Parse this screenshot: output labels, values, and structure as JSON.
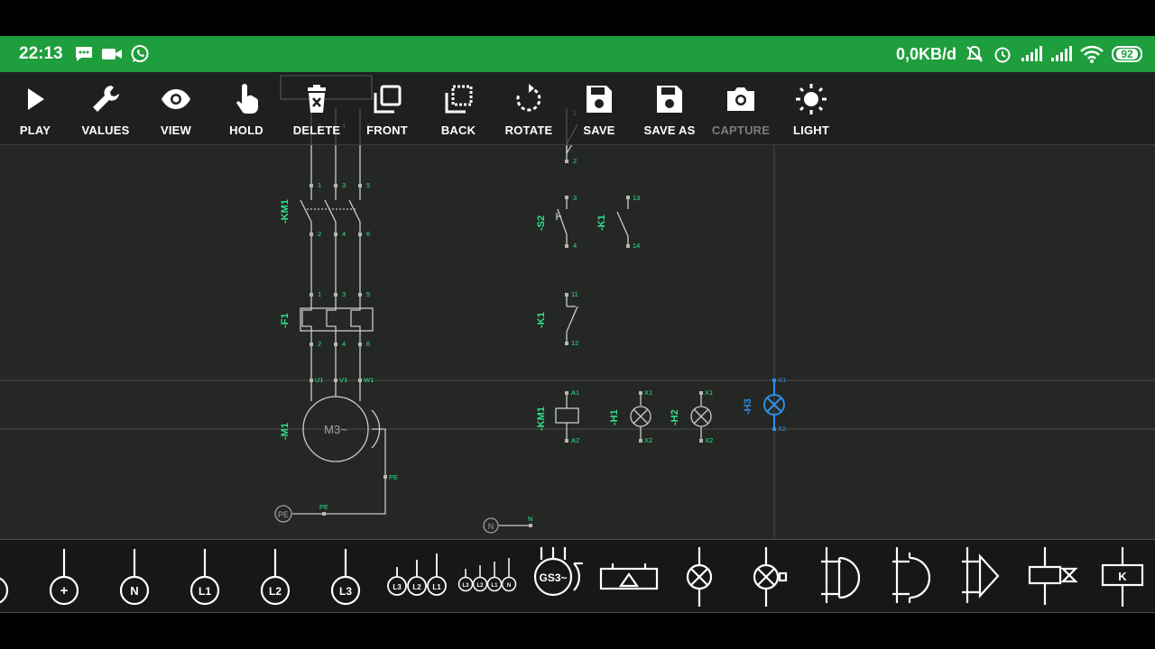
{
  "status": {
    "time": "22:13",
    "net_speed": "0,0KB/d",
    "battery": "92",
    "icons": [
      "chat-icon",
      "video-icon",
      "whatsapp-icon",
      "mute-icon",
      "alarm-icon",
      "signal-icon",
      "signal-icon",
      "wifi-icon"
    ]
  },
  "toolbar": [
    {
      "label": "PLAY",
      "icon": "play-icon"
    },
    {
      "label": "VALUES",
      "icon": "wrench-icon"
    },
    {
      "label": "VIEW",
      "icon": "eye-icon"
    },
    {
      "label": "HOLD",
      "icon": "hand-icon"
    },
    {
      "label": "DELETE",
      "icon": "trash-icon"
    },
    {
      "label": "FRONT",
      "icon": "bring-front-icon"
    },
    {
      "label": "BACK",
      "icon": "send-back-icon"
    },
    {
      "label": "ROTATE",
      "icon": "rotate-icon"
    },
    {
      "label": "SAVE",
      "icon": "save-icon"
    },
    {
      "label": "SAVE AS",
      "icon": "save-as-icon"
    },
    {
      "label": "CAPTURE",
      "icon": "camera-icon",
      "disabled": true
    },
    {
      "label": "LIGHT",
      "icon": "sun-icon"
    }
  ],
  "colors": {
    "accent": "#1e9e3c",
    "label": "#2ee28a",
    "selected": "#2d8fe6",
    "wire": "#c9cbc9"
  },
  "schematic": {
    "devices": {
      "km1_main": "-KM1",
      "f1": "-F1",
      "m1": "-M1",
      "s2": "-S2",
      "k1_no": "-K1",
      "k1_nc": "-K1",
      "km1_coil": "-KM1",
      "h1": "-H1",
      "h2": "-H2",
      "h3": "-H3"
    },
    "motor": "M3~",
    "pe_node": "PE",
    "n_node": "N",
    "pins": {
      "km1_top": [
        "1",
        "3",
        "5"
      ],
      "km1_bot": [
        "2",
        "4",
        "6"
      ],
      "f1_top": [
        "1",
        "3",
        "5"
      ],
      "f1_bot": [
        "2",
        "4",
        "6"
      ],
      "motor": [
        "U1",
        "V1",
        "W1"
      ],
      "motor_pe": "PE",
      "pe_wire": "PE",
      "n_wire": "N",
      "top_switch": [
        "1",
        "2"
      ],
      "s2": [
        "3",
        "4"
      ],
      "k1_no": [
        "13",
        "14"
      ],
      "k1_nc": [
        "11",
        "12"
      ],
      "coil": [
        "A1",
        "A2"
      ],
      "lamp": [
        "X1",
        "X2"
      ]
    },
    "hidden_pins": [
      "2",
      "4",
      "6"
    ]
  },
  "palette": {
    "nodes": {
      "plus": "+",
      "n": "N",
      "l1": "L1",
      "l2": "L2",
      "l3": "L3"
    },
    "groups": {
      "three": [
        "L3",
        "L2",
        "L1"
      ],
      "four": [
        "L3",
        "L2",
        "L1",
        "N"
      ]
    },
    "gs3": "GS3~",
    "relay": "K",
    "items": [
      "node-terminal-item",
      "plus-node-item",
      "neutral-node-item",
      "l1-node-item",
      "l2-node-item",
      "l3-node-item",
      "three-phase-group-item",
      "three-phase-neutral-group-item",
      "generator-item",
      "buzzer-item",
      "lamp-item",
      "lamp-test-item",
      "and-gate-item",
      "nand-gate-item",
      "buffer-item",
      "timer-relay-item",
      "relay-item"
    ]
  }
}
